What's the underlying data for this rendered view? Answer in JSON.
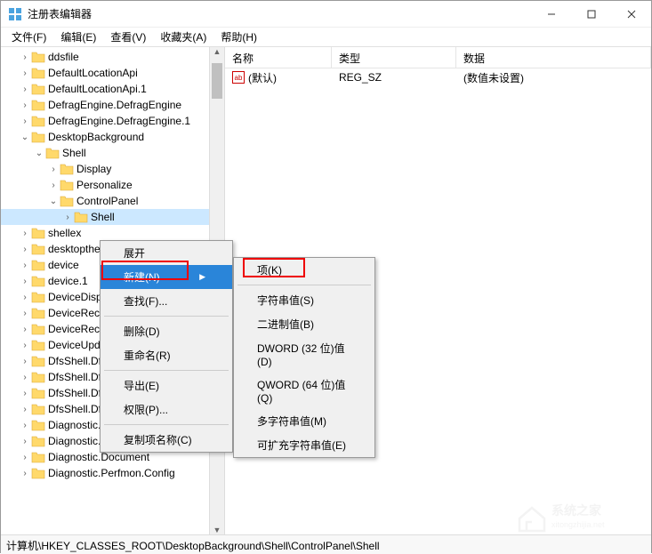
{
  "window": {
    "title": "注册表编辑器"
  },
  "menu": {
    "file": "文件(F)",
    "edit": "编辑(E)",
    "view": "查看(V)",
    "favorites": "收藏夹(A)",
    "help": "帮助(H)"
  },
  "tree": {
    "items": [
      {
        "d": 1,
        "tw": "›",
        "label": "ddsfile"
      },
      {
        "d": 1,
        "tw": "›",
        "label": "DefaultLocationApi"
      },
      {
        "d": 1,
        "tw": "›",
        "label": "DefaultLocationApi.1"
      },
      {
        "d": 1,
        "tw": "›",
        "label": "DefragEngine.DefragEngine"
      },
      {
        "d": 1,
        "tw": "›",
        "label": "DefragEngine.DefragEngine.1"
      },
      {
        "d": 1,
        "tw": "⌄",
        "label": "DesktopBackground"
      },
      {
        "d": 2,
        "tw": "⌄",
        "label": "Shell"
      },
      {
        "d": 3,
        "tw": "›",
        "label": "Display"
      },
      {
        "d": 3,
        "tw": "›",
        "label": "Personalize"
      },
      {
        "d": 3,
        "tw": "⌄",
        "label": "ControlPanel"
      },
      {
        "d": 4,
        "tw": "›",
        "label": "Shell",
        "sel": true
      },
      {
        "d": 1,
        "tw": "›",
        "label": "shellex"
      },
      {
        "d": 1,
        "tw": "›",
        "label": "desktopthe"
      },
      {
        "d": 1,
        "tw": "›",
        "label": "device"
      },
      {
        "d": 1,
        "tw": "›",
        "label": "device.1"
      },
      {
        "d": 1,
        "tw": "›",
        "label": "DeviceDisp"
      },
      {
        "d": 1,
        "tw": "›",
        "label": "DeviceRect"
      },
      {
        "d": 1,
        "tw": "›",
        "label": "DeviceRect"
      },
      {
        "d": 1,
        "tw": "›",
        "label": "DeviceUpd"
      },
      {
        "d": 1,
        "tw": "›",
        "label": "DfsShell.Df"
      },
      {
        "d": 1,
        "tw": "›",
        "label": "DfsShell.Df"
      },
      {
        "d": 1,
        "tw": "›",
        "label": "DfsShell.DfsShellAdmin"
      },
      {
        "d": 1,
        "tw": "›",
        "label": "DfsShell.DfsShellAdmin.1"
      },
      {
        "d": 1,
        "tw": "›",
        "label": "Diagnostic.Cabinet"
      },
      {
        "d": 1,
        "tw": "›",
        "label": "Diagnostic.Config"
      },
      {
        "d": 1,
        "tw": "›",
        "label": "Diagnostic.Document"
      },
      {
        "d": 1,
        "tw": "›",
        "label": "Diagnostic.Perfmon.Config"
      }
    ]
  },
  "list": {
    "cols": {
      "name": "名称",
      "type": "类型",
      "data": "数据"
    },
    "row": {
      "name": "(默认)",
      "type": "REG_SZ",
      "data": "(数值未设置)"
    }
  },
  "ctx1": {
    "expand": "展开",
    "new": "新建(N)",
    "find": "查找(F)...",
    "delete": "删除(D)",
    "rename": "重命名(R)",
    "export": "导出(E)",
    "perm": "权限(P)...",
    "copyname": "复制项名称(C)"
  },
  "ctx2": {
    "key": "项(K)",
    "string": "字符串值(S)",
    "binary": "二进制值(B)",
    "dword": "DWORD (32 位)值(D)",
    "qword": "QWORD (64 位)值(Q)",
    "multi": "多字符串值(M)",
    "expand": "可扩充字符串值(E)"
  },
  "status": "计算机\\HKEY_CLASSES_ROOT\\DesktopBackground\\Shell\\ControlPanel\\Shell",
  "watermark": {
    "main": "系统之家",
    "sub": "xitongzhijia.net"
  }
}
